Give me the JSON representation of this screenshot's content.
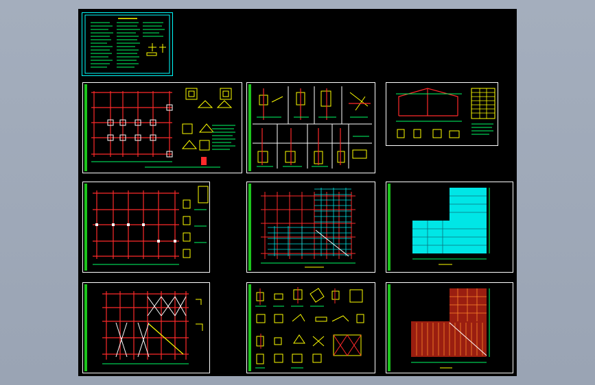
{
  "window": {
    "title": "",
    "background_color": "#9ea8b8",
    "canvas_color": "#000000"
  },
  "colors": {
    "frame": "#ffffff",
    "grid_line": "#ff2a2a",
    "dim_line": "#00ff66",
    "highlight_fill": "#00e6e6",
    "roof_fill": "#c22a14",
    "text_yellow": "#ffff00",
    "title_strip": "#1cc41c"
  },
  "sheets": [
    {
      "id": "design-notes",
      "icon": "notes-sheet-icon"
    },
    {
      "id": "foundation-plan",
      "icon": "foundation-plan-icon"
    },
    {
      "id": "node-details",
      "icon": "details-icon"
    },
    {
      "id": "frame-elevation",
      "icon": "elevation-icon"
    },
    {
      "id": "column-layout",
      "icon": "column-plan-icon"
    },
    {
      "id": "purlin-layout",
      "icon": "purlin-plan-icon"
    },
    {
      "id": "roof-panel-plan",
      "icon": "roof-plan-icon"
    },
    {
      "id": "bracing-plan",
      "icon": "bracing-plan-icon"
    },
    {
      "id": "connection-details",
      "icon": "connections-icon"
    },
    {
      "id": "roofing-plan",
      "icon": "roofing-plan-icon"
    }
  ]
}
